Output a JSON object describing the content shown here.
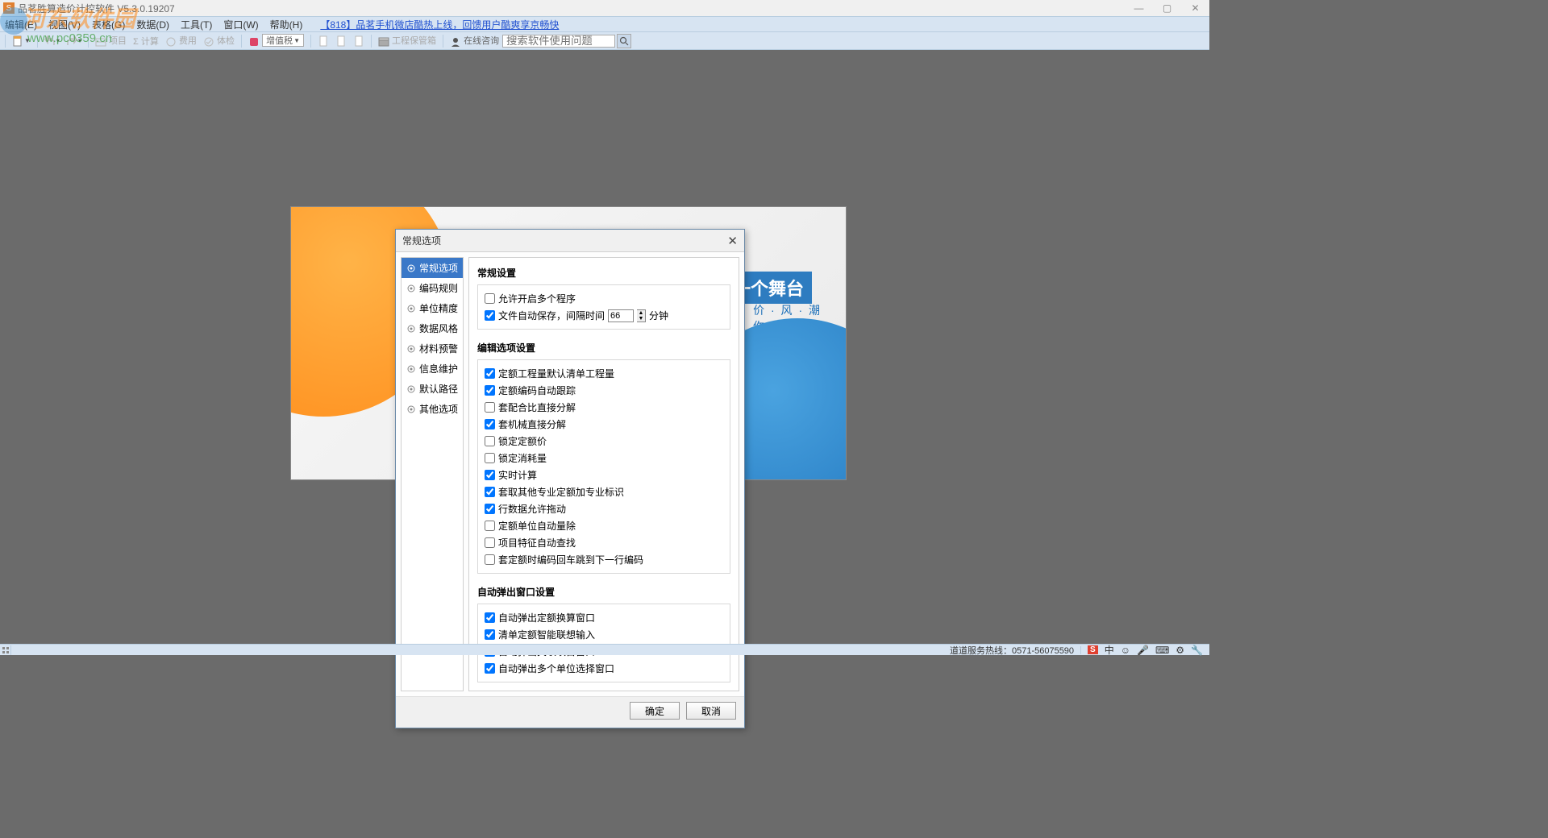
{
  "app": {
    "title": "品茗胜算造价计控软件    V5.3.0.19207",
    "icon_letter": "S"
  },
  "watermark": {
    "brand": "河东软件园",
    "url": "www.pc0359.cn"
  },
  "window_controls": {
    "minimize": "—",
    "maximize": "▢",
    "close": "✕"
  },
  "menubar": {
    "items": [
      {
        "label": "编辑(E)"
      },
      {
        "label": "视图(V)"
      },
      {
        "label": "表格(G)"
      },
      {
        "label": "数据(D)"
      },
      {
        "label": "工具(T)"
      },
      {
        "label": "窗口(W)"
      },
      {
        "label": "帮助(H)"
      }
    ],
    "promo": "【818】品茗手机微店酷热上线，回馈用户酷爽享京畅快"
  },
  "toolbar": {
    "items": [
      {
        "name": "new-file",
        "label": ""
      },
      {
        "name": "undo",
        "label": ""
      },
      {
        "name": "redo",
        "label": ""
      },
      {
        "name": "project",
        "label": "项目"
      },
      {
        "name": "calc-sigma",
        "label": "Σ 计算"
      },
      {
        "name": "fees",
        "label": "费用"
      },
      {
        "name": "check",
        "label": "体检"
      }
    ],
    "vat_label": "增值税",
    "blueprint_label": "工程保管箱",
    "consult_label": "在线咨询",
    "search_placeholder": "搜索软件使用问题"
  },
  "bg_art": {
    "line1": "一个舞台",
    "line2": "价 · 风 · 潮",
    "line3": "你 · 而 · 生"
  },
  "dialog": {
    "title": "常规选项",
    "nav": [
      {
        "label": "常规选项",
        "active": true
      },
      {
        "label": "编码规则"
      },
      {
        "label": "单位精度"
      },
      {
        "label": "数据风格"
      },
      {
        "label": "材料预警"
      },
      {
        "label": "信息维护"
      },
      {
        "label": "默认路径"
      },
      {
        "label": "其他选项"
      }
    ],
    "section1": {
      "title": "常规设置",
      "allow_multi": {
        "label": "允许开启多个程序",
        "checked": false
      },
      "autosave": {
        "label": "文件自动保存，间隔时间",
        "checked": true,
        "value": "66",
        "unit": "分钟"
      }
    },
    "section2": {
      "title": "编辑选项设置",
      "left": [
        {
          "label": "定额工程量默认清单工程量",
          "checked": true
        },
        {
          "label": "定额编码自动跟踪",
          "checked": true
        },
        {
          "label": "套配合比直接分解",
          "checked": false
        },
        {
          "label": "套机械直接分解",
          "checked": true
        },
        {
          "label": "锁定定额价",
          "checked": false
        },
        {
          "label": "锁定消耗量",
          "checked": false
        }
      ],
      "right": [
        {
          "label": "实时计算",
          "checked": true
        },
        {
          "label": "套取其他专业定额加专业标识",
          "checked": true
        },
        {
          "label": "行数据允许拖动",
          "checked": true
        },
        {
          "label": "定额单位自动量除",
          "checked": false
        },
        {
          "label": "项目特征自动查找",
          "checked": false
        },
        {
          "label": "套定额时编码回车跳到下一行编码",
          "checked": false
        }
      ]
    },
    "section3": {
      "title": "自动弹出窗口设置",
      "left": [
        {
          "label": "自动弹出定额换算窗口",
          "checked": true
        },
        {
          "label": "清单定额智能联想输入",
          "checked": true
        }
      ],
      "right": [
        {
          "label": "自动弹出关联项目窗口",
          "checked": true
        },
        {
          "label": "自动弹出多个单位选择窗口",
          "checked": true
        }
      ]
    },
    "buttons": {
      "ok": "确定",
      "cancel": "取消"
    }
  },
  "statusbar": {
    "hotline": "道道服务热线：0571-56075590",
    "ime": "S",
    "lang": "中"
  }
}
